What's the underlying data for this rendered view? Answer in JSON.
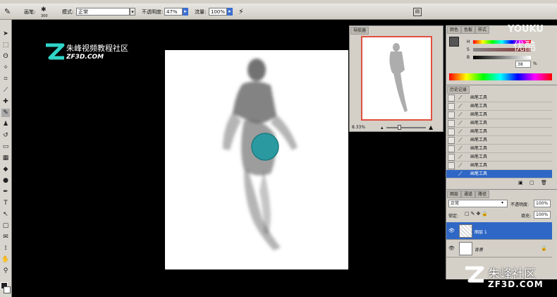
{
  "toolbar": {
    "brush_label": "画笔:",
    "brush_size": "300",
    "mode_label": "模式:",
    "mode_value": "正常",
    "opacity_label": "不透明度:",
    "opacity_value": "47%",
    "flow_label": "流量:",
    "flow_value": "100%"
  },
  "navigator": {
    "tab_label": "导航器",
    "zoom": "8.33%"
  },
  "color_panel": {
    "tab_color": "颜色",
    "tab_swatches": "色板",
    "tab_styles": "样式",
    "h_label": "H",
    "s_label": "S",
    "b_label": "B",
    "b_value": "38",
    "percent": "%"
  },
  "history": {
    "tab_label": "历史记录",
    "items": [
      {
        "label": "画笔工具"
      },
      {
        "label": "画笔工具"
      },
      {
        "label": "画笔工具"
      },
      {
        "label": "画笔工具"
      },
      {
        "label": "画笔工具"
      },
      {
        "label": "画笔工具"
      },
      {
        "label": "画笔工具"
      },
      {
        "label": "画笔工具"
      },
      {
        "label": "画笔工具"
      },
      {
        "label": "画笔工具"
      }
    ]
  },
  "layers": {
    "tab_layers": "图层",
    "tab_channels": "通道",
    "tab_paths": "路径",
    "blend_mode": "正常",
    "opacity_label": "不透明度:",
    "opacity_value": "100%",
    "lock_label": "锁定:",
    "fill_label": "填充:",
    "fill_value": "100%",
    "items": [
      {
        "name": "图层 1"
      },
      {
        "name": "背景"
      }
    ]
  },
  "watermarks": {
    "top_left_cn": "朱峰视频教程社区",
    "top_left_en": "ZF3D.COM",
    "top_right_en": "YOUKU",
    "top_right_cn": "优酷",
    "bottom_right_cn": "朱峰社区",
    "bottom_right_en": "ZF3D.COM"
  },
  "colors": {
    "teal_cursor": "#2a9aa0",
    "selection_blue": "#2f67c6",
    "nav_frame": "#e05040"
  }
}
